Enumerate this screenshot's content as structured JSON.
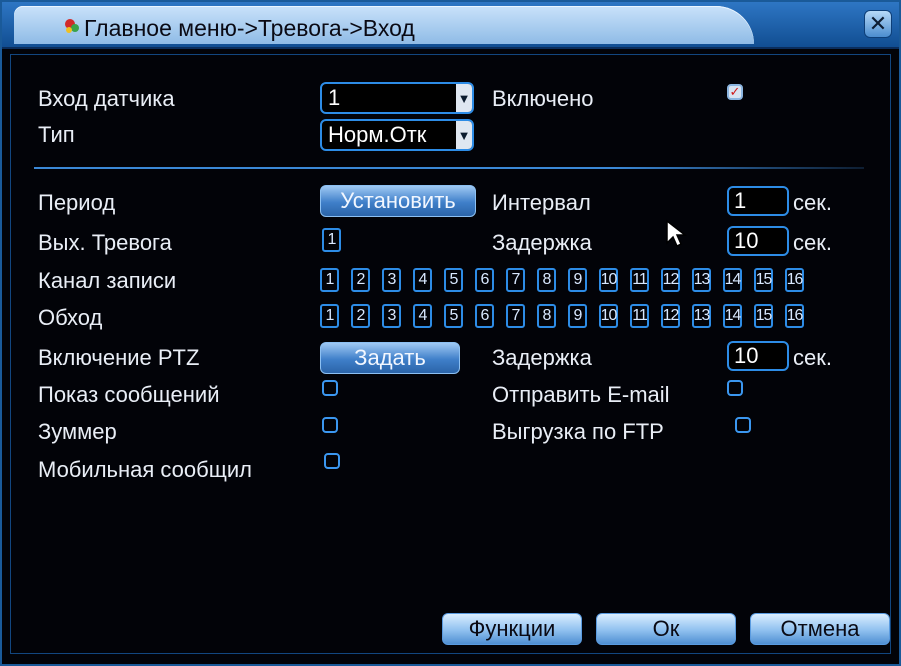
{
  "title": "Главное меню->Тревога->Вход",
  "close_icon": "close-x",
  "sensor_input": {
    "label": "Вход датчика",
    "value": "1"
  },
  "enabled": {
    "label": "Включено",
    "checked": true
  },
  "type": {
    "label": "Тип",
    "value": "Норм.Отк"
  },
  "period": {
    "label": "Период",
    "button": "Установить"
  },
  "interval": {
    "label": "Интервал",
    "value": "1",
    "unit": "сек."
  },
  "alarm_out": {
    "label": "Вых. Тревога",
    "channel": "1"
  },
  "delay1": {
    "label": "Задержка",
    "value": "10",
    "unit": "сек."
  },
  "record_channel": {
    "label": "Канал записи",
    "channels": [
      "1",
      "2",
      "3",
      "4",
      "5",
      "6",
      "7",
      "8",
      "9",
      "10",
      "11",
      "12",
      "13",
      "14",
      "15",
      "16"
    ]
  },
  "tour": {
    "label": "Обход",
    "channels": [
      "1",
      "2",
      "3",
      "4",
      "5",
      "6",
      "7",
      "8",
      "9",
      "10",
      "11",
      "12",
      "13",
      "14",
      "15",
      "16"
    ]
  },
  "ptz": {
    "label": "Включение PTZ",
    "button": "Задать"
  },
  "delay2": {
    "label": "Задержка",
    "value": "10",
    "unit": "сек."
  },
  "show_message": {
    "label": "Показ сообщений",
    "checked": false
  },
  "send_email": {
    "label": "Отправить E-mail",
    "checked": false
  },
  "buzzer": {
    "label": "Зуммер",
    "checked": false
  },
  "ftp_upload": {
    "label": "Выгрузка по FTP",
    "checked": false
  },
  "mobile": {
    "label": "Мобильная сообщил",
    "checked": false
  },
  "footer": {
    "functions": "Функции",
    "ok": "Ок",
    "cancel": "Отмена"
  },
  "colors": {
    "accent": "#2d8ce6",
    "titlebar": "#2e76c4",
    "background": "#020308"
  }
}
